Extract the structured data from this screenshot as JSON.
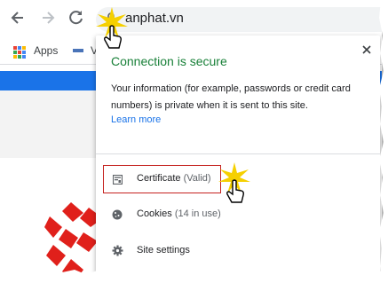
{
  "browser": {
    "url": "anphat.vn",
    "bookmarks": {
      "apps_label": "Apps",
      "second_label": "V"
    }
  },
  "popup": {
    "title": "Connection is secure",
    "description": "Your information (for example, passwords or credit card numbers) is private when it is sent to this site.",
    "learn_more": "Learn more",
    "certificate": {
      "label": "Certificate",
      "status": "(Valid)"
    },
    "cookies": {
      "label": "Cookies",
      "count": "(14 in use)"
    },
    "site_settings": "Site settings"
  },
  "colors": {
    "secure_green": "#188038",
    "link_blue": "#1a73e8",
    "highlight_red": "#c5221f",
    "logo_red": "#e0201b"
  },
  "icons": [
    "back-arrow-icon",
    "forward-arrow-icon",
    "reload-icon",
    "lock-icon",
    "apps-grid-icon",
    "close-icon",
    "certificate-icon",
    "cookie-icon",
    "gear-icon",
    "hand-cursor-icon",
    "click-burst-icon"
  ]
}
